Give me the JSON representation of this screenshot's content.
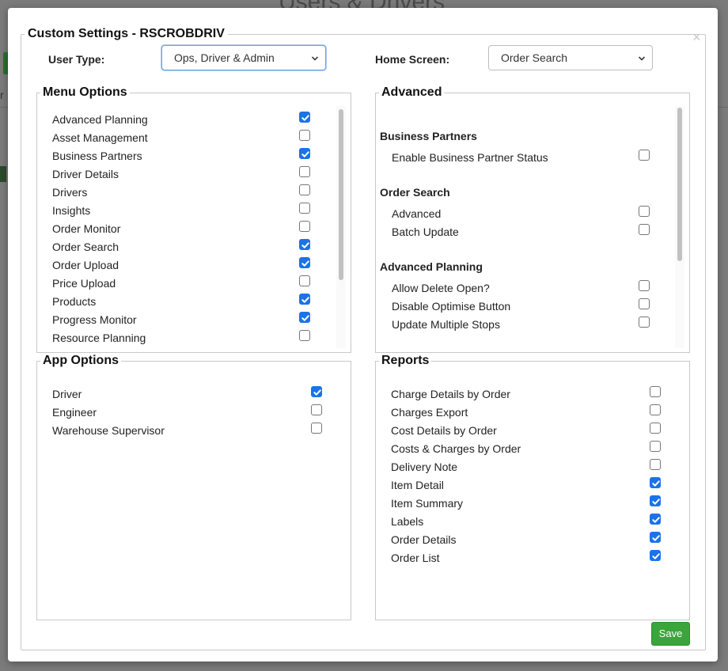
{
  "background": {
    "title": "Users & Drivers"
  },
  "modal": {
    "title": "Custom Settings - RSCROBDRIV",
    "close_glyph": "×",
    "user_type": {
      "label": "User Type:",
      "value": "Ops, Driver & Admin"
    },
    "home_screen": {
      "label": "Home Screen:",
      "value": "Order Search"
    },
    "save_label": "Save"
  },
  "menu_options": {
    "title": "Menu Options",
    "items": [
      {
        "label": "Advanced Planning",
        "checked": true
      },
      {
        "label": "Asset Management",
        "checked": false
      },
      {
        "label": "Business Partners",
        "checked": true
      },
      {
        "label": "Driver Details",
        "checked": false
      },
      {
        "label": "Drivers",
        "checked": false
      },
      {
        "label": "Insights",
        "checked": false
      },
      {
        "label": "Order Monitor",
        "checked": false
      },
      {
        "label": "Order Search",
        "checked": true
      },
      {
        "label": "Order Upload",
        "checked": true
      },
      {
        "label": "Price Upload",
        "checked": false
      },
      {
        "label": "Products",
        "checked": true
      },
      {
        "label": "Progress Monitor",
        "checked": true
      },
      {
        "label": "Resource Planning",
        "checked": false
      }
    ]
  },
  "advanced": {
    "title": "Advanced",
    "groups": [
      {
        "header": "Business Partners",
        "items": [
          {
            "label": "Enable Business Partner Status",
            "checked": false
          }
        ]
      },
      {
        "header": "Order Search",
        "items": [
          {
            "label": "Advanced",
            "checked": false
          },
          {
            "label": "Batch Update",
            "checked": false
          }
        ]
      },
      {
        "header": "Advanced Planning",
        "items": [
          {
            "label": "Allow Delete Open?",
            "checked": false
          },
          {
            "label": "Disable Optimise Button",
            "checked": false
          },
          {
            "label": "Update Multiple Stops",
            "checked": false
          }
        ]
      }
    ]
  },
  "app_options": {
    "title": "App Options",
    "items": [
      {
        "label": "Driver",
        "checked": true
      },
      {
        "label": "Engineer",
        "checked": false
      },
      {
        "label": "Warehouse Supervisor",
        "checked": false
      }
    ]
  },
  "reports": {
    "title": "Reports",
    "items": [
      {
        "label": "Charge Details by Order",
        "checked": false
      },
      {
        "label": "Charges Export",
        "checked": false
      },
      {
        "label": "Cost Details by Order",
        "checked": false
      },
      {
        "label": "Costs & Charges by Order",
        "checked": false
      },
      {
        "label": "Delivery Note",
        "checked": false
      },
      {
        "label": "Item Detail",
        "checked": true
      },
      {
        "label": "Item Summary",
        "checked": true
      },
      {
        "label": "Labels",
        "checked": true
      },
      {
        "label": "Order Details",
        "checked": true
      },
      {
        "label": "Order List",
        "checked": true
      }
    ]
  },
  "colors": {
    "checkbox_on": "#1a73e8",
    "save_button": "#3ba53b",
    "focus_border": "#6aa2de"
  }
}
